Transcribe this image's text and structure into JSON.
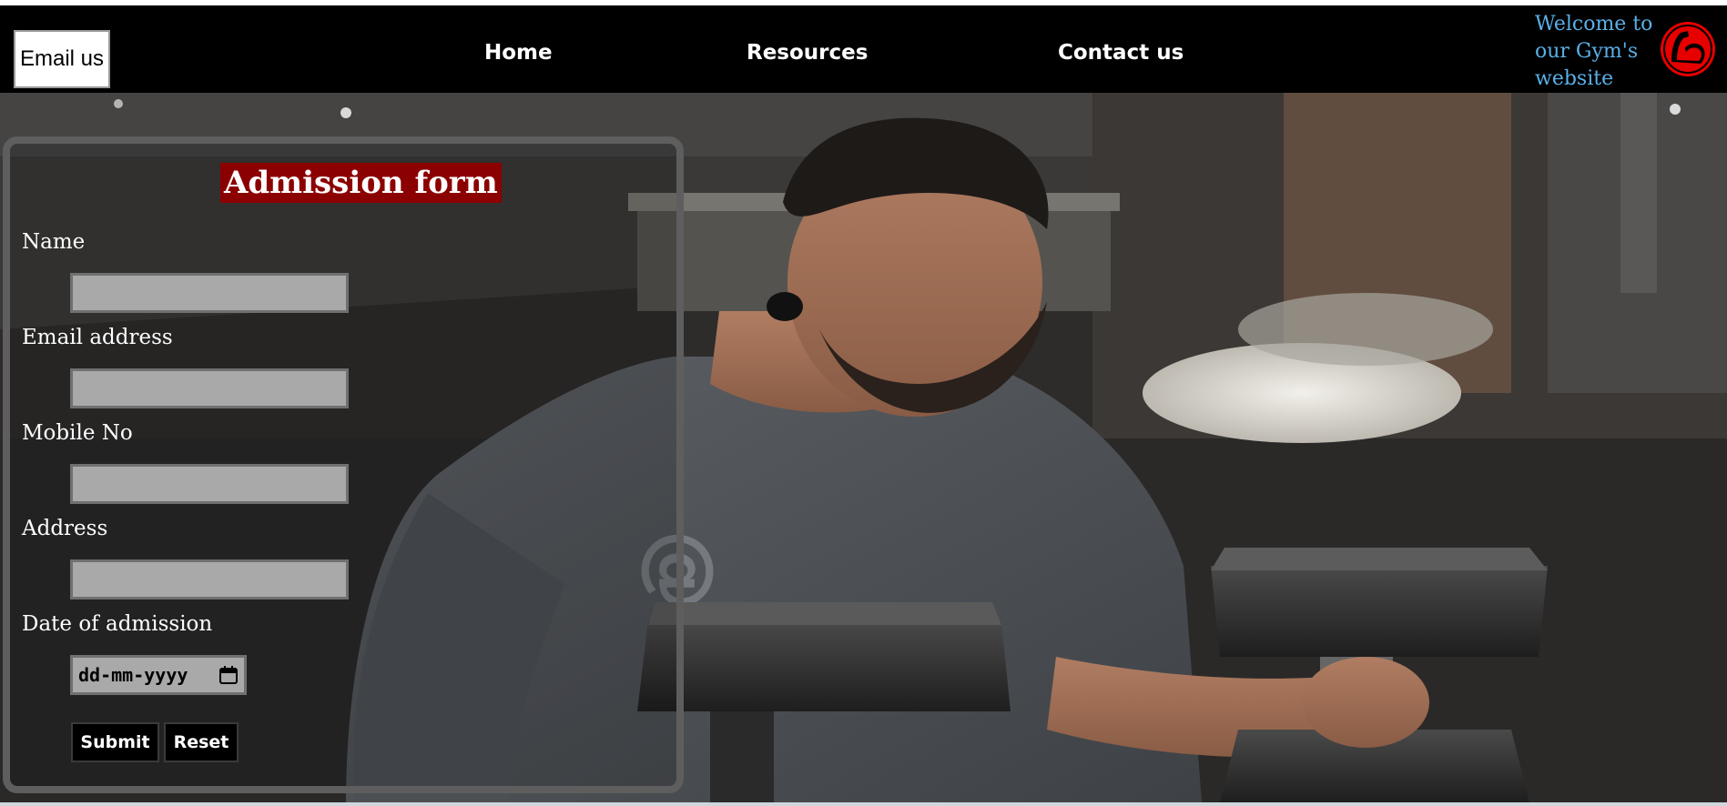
{
  "header": {
    "email_button_label": "Email us",
    "nav": {
      "home": "Home",
      "resources": "Resources",
      "contact": "Contact us"
    },
    "welcome_text": "Welcome to our Gym's website",
    "logo_icon": "flexed-bicep-icon"
  },
  "form": {
    "title": "Admission form",
    "fields": {
      "name": {
        "label": "Name",
        "value": ""
      },
      "email": {
        "label": "Email address",
        "value": ""
      },
      "mobile": {
        "label": "Mobile No",
        "value": ""
      },
      "address": {
        "label": "Address",
        "value": ""
      },
      "date": {
        "label": "Date of admission",
        "placeholder": "dd-mm-yyyy"
      }
    },
    "submit_label": "Submit",
    "reset_label": "Reset"
  },
  "colors": {
    "nav_background": "#000000",
    "welcome_text": "#5ab0e8",
    "logo_red": "#e60000",
    "form_title_background": "#8b0000",
    "input_background": "#a9a9a9"
  }
}
